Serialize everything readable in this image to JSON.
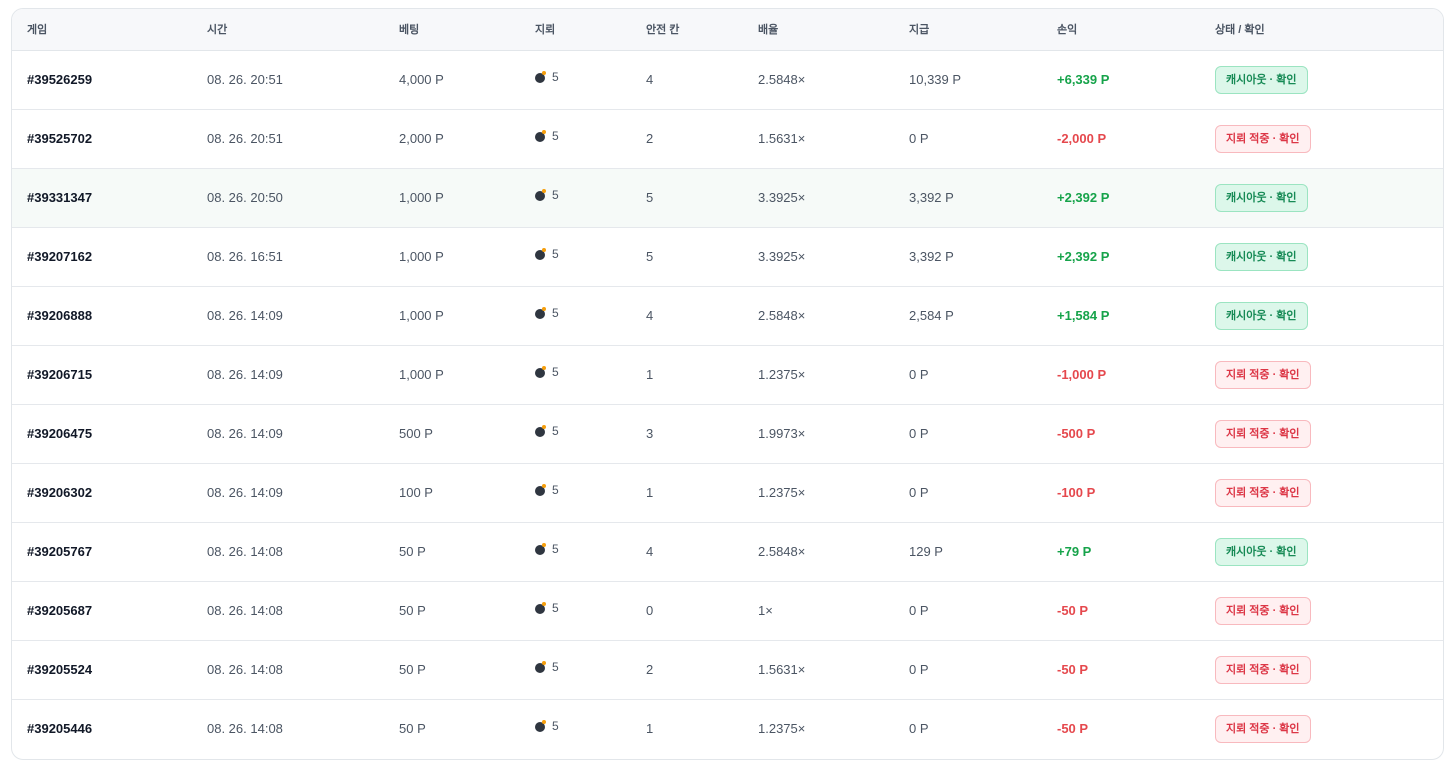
{
  "table": {
    "headers": [
      "게임",
      "시간",
      "베팅",
      "지뢰",
      "안전 칸",
      "배율",
      "지급",
      "손익",
      "상태 / 확인"
    ],
    "rows": [
      {
        "id": "#39526259",
        "time": "08. 26. 20:51",
        "bet": "4,000 P",
        "mines": "5",
        "safe": "4",
        "multiplier": "2.5848×",
        "payout": "10,339 P",
        "pl": "+6,339 P",
        "pl_type": "pos",
        "status": "캐시아웃 · 확인",
        "status_type": "win"
      },
      {
        "id": "#39525702",
        "time": "08. 26. 20:51",
        "bet": "2,000 P",
        "mines": "5",
        "safe": "2",
        "multiplier": "1.5631×",
        "payout": "0 P",
        "pl": "-2,000 P",
        "pl_type": "neg",
        "status": "지뢰 적중 · 확인",
        "status_type": "loss"
      },
      {
        "id": "#39331347",
        "time": "08. 26. 20:50",
        "bet": "1,000 P",
        "mines": "5",
        "safe": "5",
        "multiplier": "3.3925×",
        "payout": "3,392 P",
        "pl": "+2,392 P",
        "pl_type": "pos",
        "status": "캐시아웃 · 확인",
        "status_type": "win"
      },
      {
        "id": "#39207162",
        "time": "08. 26. 16:51",
        "bet": "1,000 P",
        "mines": "5",
        "safe": "5",
        "multiplier": "3.3925×",
        "payout": "3,392 P",
        "pl": "+2,392 P",
        "pl_type": "pos",
        "status": "캐시아웃 · 확인",
        "status_type": "win"
      },
      {
        "id": "#39206888",
        "time": "08. 26. 14:09",
        "bet": "1,000 P",
        "mines": "5",
        "safe": "4",
        "multiplier": "2.5848×",
        "payout": "2,584 P",
        "pl": "+1,584 P",
        "pl_type": "pos",
        "status": "캐시아웃 · 확인",
        "status_type": "win"
      },
      {
        "id": "#39206715",
        "time": "08. 26. 14:09",
        "bet": "1,000 P",
        "mines": "5",
        "safe": "1",
        "multiplier": "1.2375×",
        "payout": "0 P",
        "pl": "-1,000 P",
        "pl_type": "neg",
        "status": "지뢰 적중 · 확인",
        "status_type": "loss"
      },
      {
        "id": "#39206475",
        "time": "08. 26. 14:09",
        "bet": "500 P",
        "mines": "5",
        "safe": "3",
        "multiplier": "1.9973×",
        "payout": "0 P",
        "pl": "-500 P",
        "pl_type": "neg",
        "status": "지뢰 적중 · 확인",
        "status_type": "loss"
      },
      {
        "id": "#39206302",
        "time": "08. 26. 14:09",
        "bet": "100 P",
        "mines": "5",
        "safe": "1",
        "multiplier": "1.2375×",
        "payout": "0 P",
        "pl": "-100 P",
        "pl_type": "neg",
        "status": "지뢰 적중 · 확인",
        "status_type": "loss"
      },
      {
        "id": "#39205767",
        "time": "08. 26. 14:08",
        "bet": "50 P",
        "mines": "5",
        "safe": "4",
        "multiplier": "2.5848×",
        "payout": "129 P",
        "pl": "+79 P",
        "pl_type": "pos",
        "status": "캐시아웃 · 확인",
        "status_type": "win"
      },
      {
        "id": "#39205687",
        "time": "08. 26. 14:08",
        "bet": "50 P",
        "mines": "5",
        "safe": "0",
        "multiplier": "1×",
        "payout": "0 P",
        "pl": "-50 P",
        "pl_type": "neg",
        "status": "지뢰 적중 · 확인",
        "status_type": "loss"
      },
      {
        "id": "#39205524",
        "time": "08. 26. 14:08",
        "bet": "50 P",
        "mines": "5",
        "safe": "2",
        "multiplier": "1.5631×",
        "payout": "0 P",
        "pl": "-50 P",
        "pl_type": "neg",
        "status": "지뢰 적중 · 확인",
        "status_type": "loss"
      },
      {
        "id": "#39205446",
        "time": "08. 26. 14:08",
        "bet": "50 P",
        "mines": "5",
        "safe": "1",
        "multiplier": "1.2375×",
        "payout": "0 P",
        "pl": "-50 P",
        "pl_type": "neg",
        "status": "지뢰 적중 · 확인",
        "status_type": "loss"
      }
    ],
    "hovered_row_index": 2,
    "icons": {
      "mines": "bomb-icon"
    }
  },
  "colors": {
    "profit": "#16a34a",
    "loss": "#e5484d",
    "win_badge_bg": "#dcf7ea",
    "loss_badge_bg": "#fff0f1"
  }
}
